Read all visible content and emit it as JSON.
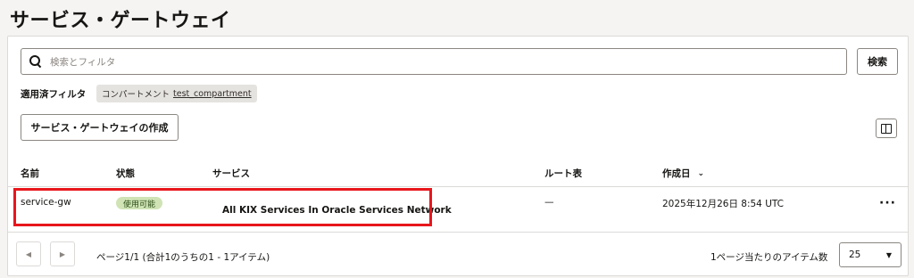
{
  "page": {
    "title": "サービス・ゲートウェイ"
  },
  "search": {
    "placeholder": "検索とフィルタ",
    "button_label": "検索"
  },
  "filters": {
    "label": "適用済フィルタ",
    "chips": [
      {
        "key": "コンパートメント",
        "value": "test_compartment"
      }
    ]
  },
  "toolbar": {
    "create_label": "サービス・ゲートウェイの作成"
  },
  "table": {
    "columns": [
      "名前",
      "状態",
      "サービス",
      "ルート表",
      "作成日"
    ],
    "sort_indicator": "⌄",
    "rows": [
      {
        "name": "service-gw",
        "status": "使用可能",
        "services": "All KIX Services In Oracle Services Network",
        "route_table": "—",
        "created": "2025年12月26日 8:54 UTC",
        "actions": "···"
      }
    ]
  },
  "pagination": {
    "prev_glyph": "◀",
    "next_glyph": "▶",
    "status": "ページ1/1 (合計1のうちの1 - 1アイテム)",
    "per_page_label": "1ページ当たりのアイテム数",
    "per_page_value": "25"
  },
  "colors": {
    "highlight": "#e8161c",
    "status_available_bg": "#cfe3b5",
    "status_available_text": "#2b4d16"
  }
}
